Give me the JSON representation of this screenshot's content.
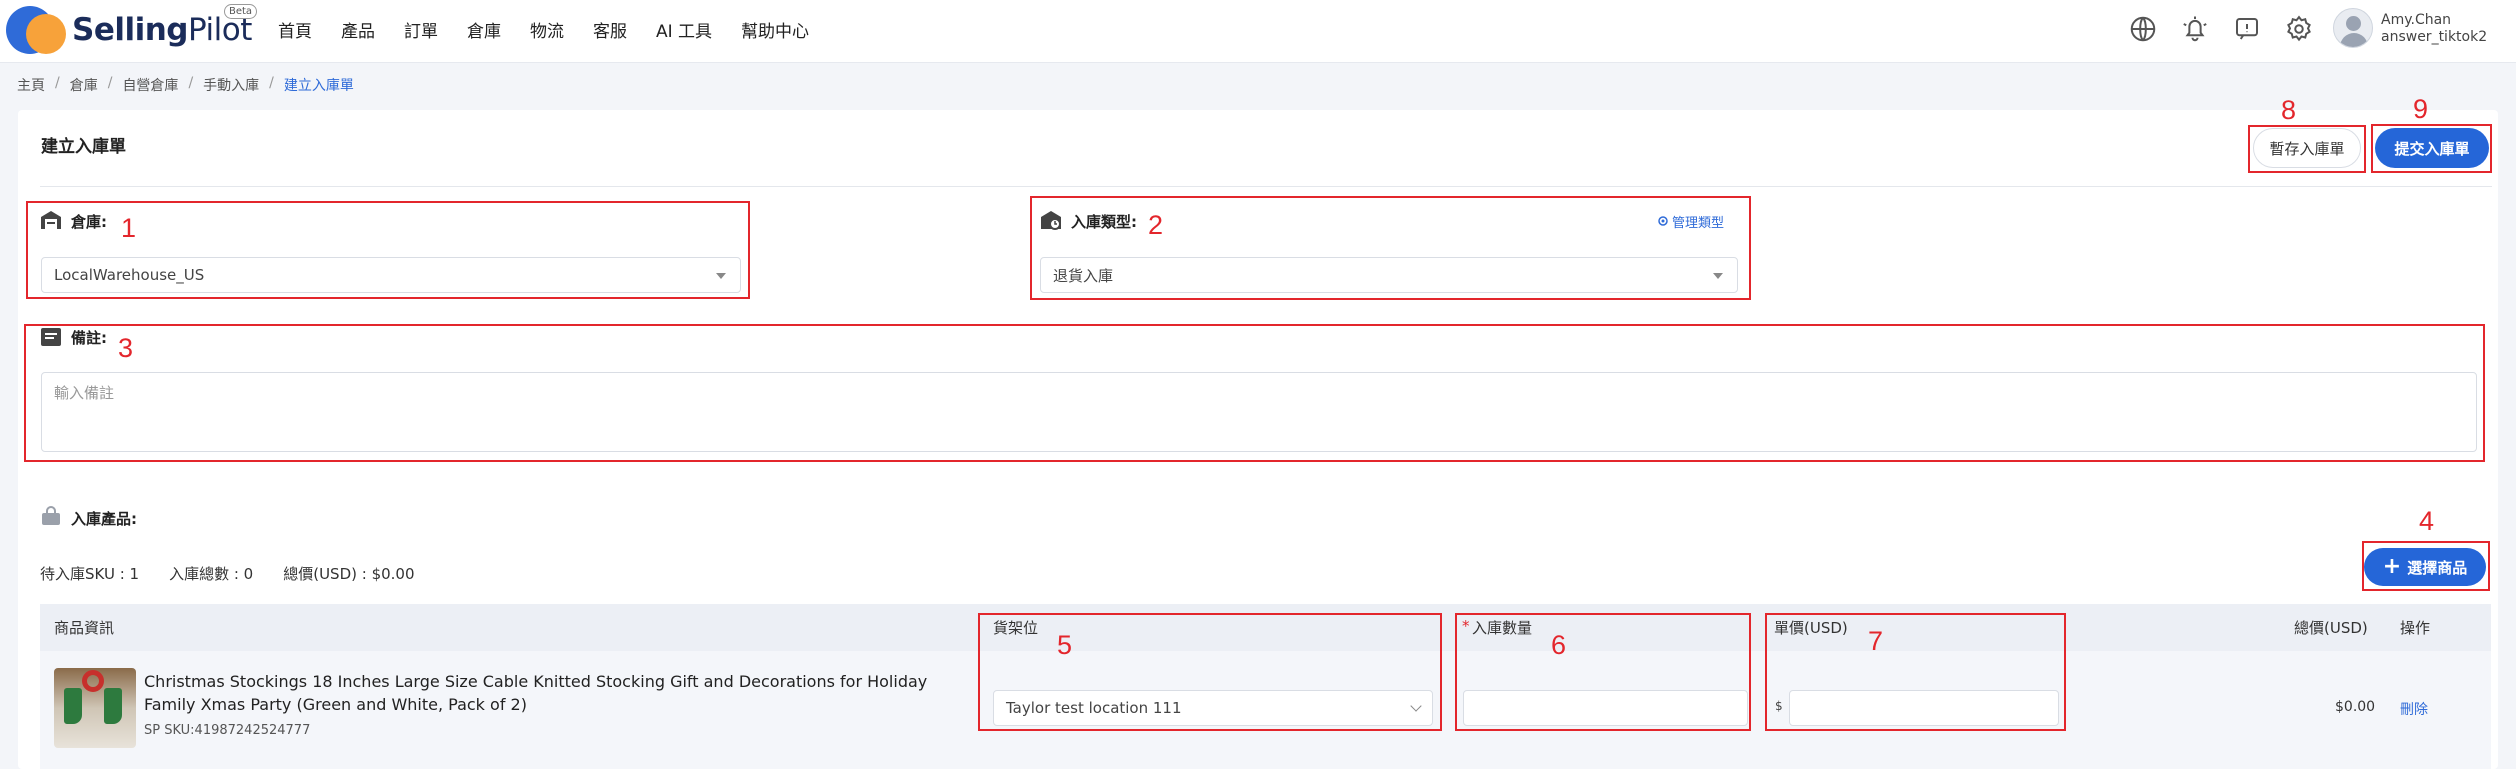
{
  "brand": {
    "name_bold": "Selling",
    "name_light": "Pilot",
    "badge": "Beta"
  },
  "nav": [
    "首頁",
    "產品",
    "訂單",
    "倉庫",
    "物流",
    "客服",
    "AI 工具",
    "幫助中心"
  ],
  "user": {
    "name": "Amy.Chan",
    "account": "answer_tiktok2"
  },
  "breadcrumb": [
    "主頁",
    "倉庫",
    "自營倉庫",
    "手動入庫",
    "建立入庫單"
  ],
  "page": {
    "title": "建立入庫單",
    "save_draft": "暫存入庫單",
    "submit": "提交入庫單"
  },
  "form": {
    "warehouse_label": "倉庫:",
    "warehouse_value": "LocalWarehouse_US",
    "type_label": "入庫類型:",
    "manage_type": "管理類型",
    "type_value": "退貨入庫",
    "remark_label": "備註:",
    "remark_placeholder": "輸入備註"
  },
  "products": {
    "section_label": "入庫產品:",
    "stats": [
      "待入庫SKU : 1",
      "入庫總數 : 0",
      "總價(USD) : $0.00"
    ],
    "select_button": "選擇商品",
    "columns": {
      "info": "商品資訊",
      "location": "貨架位",
      "qty_required": "*",
      "qty": "入庫數量",
      "unit_price": "單價(USD)",
      "total": "總價(USD)",
      "action": "操作"
    },
    "rows": [
      {
        "title": "Christmas Stockings 18 Inches Large Size Cable Knitted Stocking Gift and Decorations for Holiday Family Xmas Party (Green and White, Pack of 2)",
        "sku": "SP SKU:41987242524777",
        "location": "Taylor test location 111",
        "qty": "",
        "currency": "$",
        "unit_price": "",
        "total": "$0.00",
        "action": "刪除"
      }
    ]
  },
  "annotations": [
    "1",
    "2",
    "3",
    "4",
    "5",
    "6",
    "7",
    "8",
    "9"
  ],
  "colors": {
    "accent": "#2566d8",
    "annotation": "#e3262c"
  }
}
